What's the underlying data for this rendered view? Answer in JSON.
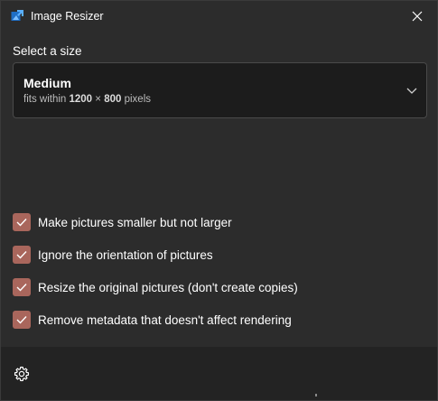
{
  "window": {
    "title": "Image Resizer",
    "accent_color": "#a9665c",
    "icons": {
      "app": "image-resizer-app-icon",
      "close": "close-icon",
      "settings": "gear-icon",
      "dropdown": "chevron-down-icon",
      "check": "checkmark-icon"
    }
  },
  "size": {
    "label": "Select a size",
    "selected": {
      "name": "Medium",
      "prefix": "fits within",
      "width": "1200",
      "times": "×",
      "height": "800",
      "unit": "pixels"
    }
  },
  "options": [
    {
      "label": "Make pictures smaller but not larger",
      "checked": true
    },
    {
      "label": "Ignore the orientation of pictures",
      "checked": true
    },
    {
      "label": "Resize the original pictures (don't create copies)",
      "checked": true
    },
    {
      "label": "Remove metadata that doesn't affect rendering",
      "checked": true
    }
  ]
}
